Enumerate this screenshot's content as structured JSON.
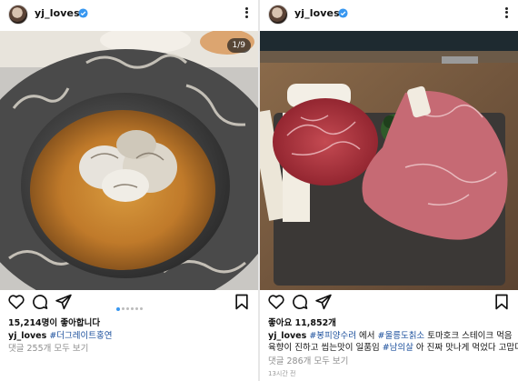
{
  "posts": [
    {
      "username": "yj_loves",
      "counter": "1/9",
      "likes": "15,214명이 좋아합니다",
      "caption_user": "yj_loves",
      "caption_tag": "#더그레이트홍연",
      "comments": "댓글 255개 모두 보기",
      "carousel_total": 9,
      "carousel_active": 1
    },
    {
      "username": "yj_loves",
      "likes": "좋아요 11,852개",
      "caption_user": "yj_loves",
      "caption_line1_tag1": "#봉피양수려",
      "caption_line1_text1": " 에서 ",
      "caption_line1_tag2": "#울릉도칡소",
      "caption_line1_text2": " 토마호크 스테이크 먹음",
      "caption_line2_text1": "육향이 진하고 씹는맛이 일품임 ",
      "caption_line2_tag": "#남의살",
      "caption_line2_text2": " 아 진짜 맛나게 먹었다 고맙다",
      "comments": "댓글 286개 모두 보기",
      "time": "13시간 전"
    }
  ],
  "colors": {
    "verified": "#3897f0",
    "hashtag": "#1b4f9c",
    "muted": "#8e8e8e"
  },
  "icons": [
    "heart-icon",
    "comment-icon",
    "send-icon",
    "bookmark-icon",
    "verified-badge-icon",
    "more-options-icon"
  ]
}
